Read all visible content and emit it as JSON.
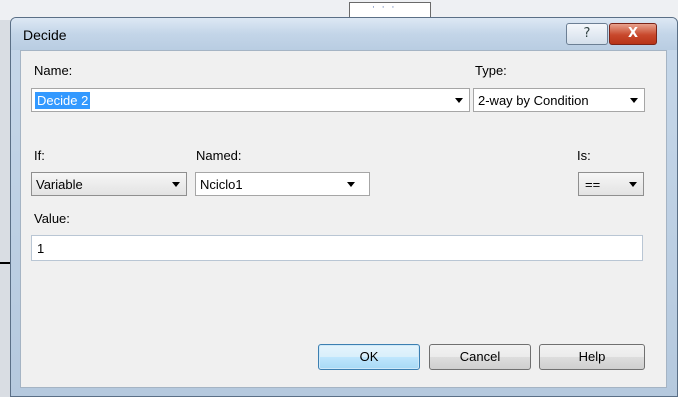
{
  "dialog": {
    "title": "Decide",
    "help_glyph": "?",
    "close_glyph": "X"
  },
  "form": {
    "name_label": "Name:",
    "name_value": "Decide 2",
    "type_label": "Type:",
    "type_value": "2-way by Condition",
    "if_label": "If:",
    "if_value": "Variable",
    "named_label": "Named:",
    "named_value": "Nciclo1",
    "is_label": "Is:",
    "is_value": "==",
    "value_label": "Value:",
    "value_value": "1"
  },
  "buttons": {
    "ok": "OK",
    "cancel": "Cancel",
    "help": "Help"
  },
  "background": {
    "tab_text": "· · ·"
  }
}
